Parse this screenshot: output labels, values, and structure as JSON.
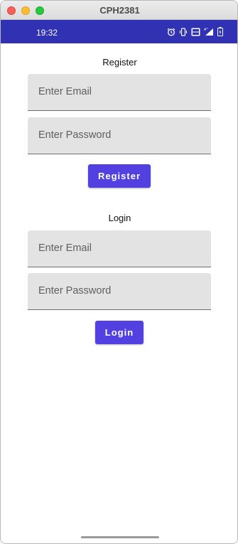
{
  "window": {
    "title": "CPH2381"
  },
  "status_bar": {
    "time": "19:32",
    "icons": [
      "alarm-icon",
      "vibrate-icon",
      "volte-icon",
      "signal-4g-icon",
      "battery-icon"
    ]
  },
  "register": {
    "heading": "Register",
    "email_placeholder": "Enter Email",
    "password_placeholder": "Enter Password",
    "button_label": "Register"
  },
  "login": {
    "heading": "Login",
    "email_placeholder": "Enter Email",
    "password_placeholder": "Enter Password",
    "button_label": "Login"
  },
  "colors": {
    "status_bar": "#3131b3",
    "button": "#5240e0",
    "field_background": "#e3e3e3"
  }
}
